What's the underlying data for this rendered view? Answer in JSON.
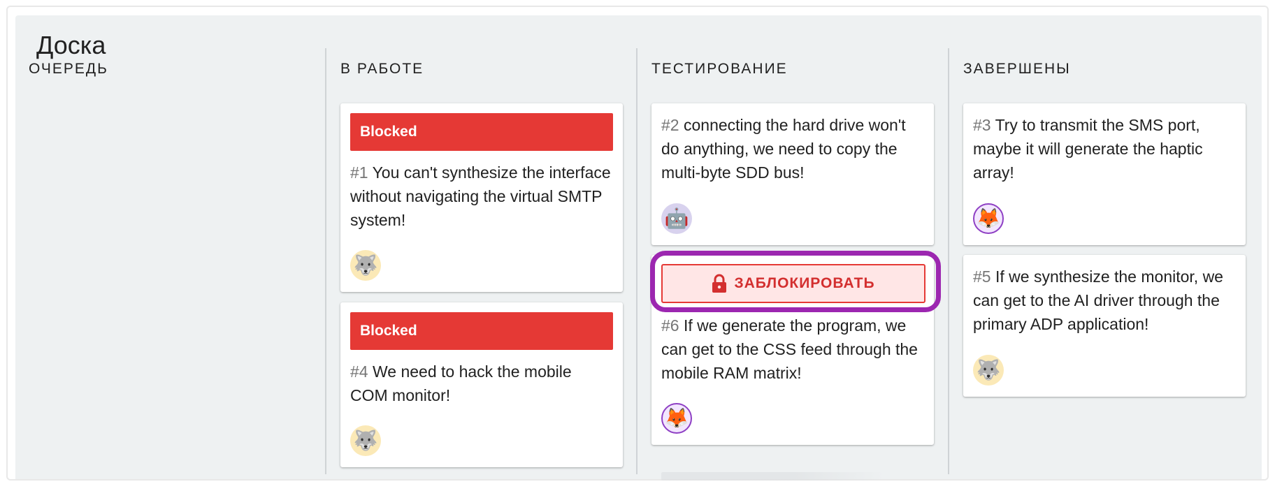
{
  "board": {
    "title": "Доска"
  },
  "columns": [
    {
      "title": "ОЧЕРЕДЬ",
      "cards": []
    },
    {
      "title": "В РАБОТЕ",
      "cards": [
        {
          "banner": "Blocked",
          "num": "#1",
          "text": " You can't synthesize the interface without navigating the virtual SMTP system!",
          "avatar": "wolf-icon",
          "avatar_glyph": "🐺"
        },
        {
          "banner": "Blocked",
          "num": "#4",
          "text": " We need to hack the mobile COM monitor!",
          "avatar": "wolf-icon",
          "avatar_glyph": "🐺"
        }
      ]
    },
    {
      "title": "ТЕСТИРОВАНИЕ",
      "cards": [
        {
          "num": "#2",
          "text": " connecting the hard drive won't do anything, we need to copy the multi-byte SDD bus!",
          "avatar": "robot-icon",
          "avatar_glyph": "🤖"
        },
        {
          "num": "#6",
          "text": " If we generate the program, we can get to the CSS feed through the mobile RAM matrix!",
          "avatar": "fox-icon",
          "avatar_glyph": "🦊"
        }
      ]
    },
    {
      "title": "ЗАВЕРШЕНЫ",
      "cards": [
        {
          "num": "#3",
          "text": " Try to transmit the SMS port, maybe it will generate the haptic array!",
          "avatar": "fox-icon",
          "avatar_glyph": "🦊"
        },
        {
          "num": "#5",
          "text": " If we synthesize the monitor, we can get to the AI driver through the primary ADP application!",
          "avatar": "wolf-icon",
          "avatar_glyph": "🐺"
        }
      ]
    }
  ],
  "block_button": {
    "label": "ЗАБЛОКИРОВАТЬ",
    "icon": "lock-icon"
  },
  "colors": {
    "blocked": "#e53935",
    "highlight": "#9c27b0",
    "board_bg": "#eef1f2"
  }
}
